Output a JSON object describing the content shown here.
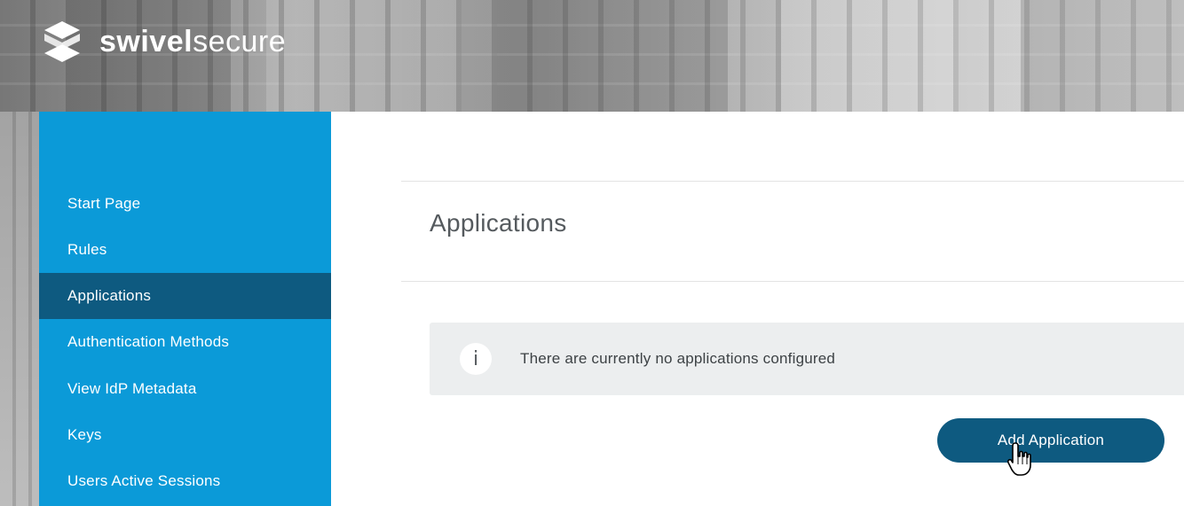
{
  "brand": {
    "name_bold": "swivel",
    "name_light": "secure",
    "logo_icon": "swivelsecure-logo-icon"
  },
  "sidebar": {
    "items": [
      {
        "label": "Start Page",
        "active": false
      },
      {
        "label": "Rules",
        "active": false
      },
      {
        "label": "Applications",
        "active": true
      },
      {
        "label": "Authentication Methods",
        "active": false
      },
      {
        "label": "View IdP Metadata",
        "active": false
      },
      {
        "label": "Keys",
        "active": false
      },
      {
        "label": "Users Active Sessions",
        "active": false
      }
    ]
  },
  "main": {
    "title": "Applications",
    "info": {
      "icon": "info-icon",
      "glyph": "i",
      "message": "There are currently no applications configured"
    },
    "add_button_label": "Add Application"
  },
  "colors": {
    "sidebar_bg": "#0b9ad8",
    "sidebar_active": "#0e5a80",
    "button_bg": "#0e5a80",
    "info_bg": "#eceeef",
    "title_text": "#555a5e"
  }
}
